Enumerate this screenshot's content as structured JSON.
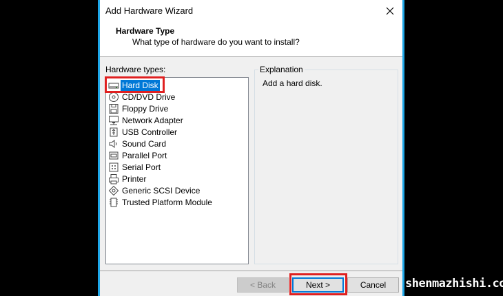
{
  "window": {
    "title": "Add Hardware Wizard"
  },
  "header": {
    "title": "Hardware Type",
    "subtitle": "What type of hardware do you want to install?"
  },
  "list": {
    "label": "Hardware types:",
    "selected_index": 0,
    "items": [
      {
        "label": "Hard Disk",
        "icon": "hard-disk-icon"
      },
      {
        "label": "CD/DVD Drive",
        "icon": "cd-dvd-drive-icon"
      },
      {
        "label": "Floppy Drive",
        "icon": "floppy-drive-icon"
      },
      {
        "label": "Network Adapter",
        "icon": "network-adapter-icon"
      },
      {
        "label": "USB Controller",
        "icon": "usb-controller-icon"
      },
      {
        "label": "Sound Card",
        "icon": "sound-card-icon"
      },
      {
        "label": "Parallel Port",
        "icon": "parallel-port-icon"
      },
      {
        "label": "Serial Port",
        "icon": "serial-port-icon"
      },
      {
        "label": "Printer",
        "icon": "printer-icon"
      },
      {
        "label": "Generic SCSI Device",
        "icon": "scsi-device-icon"
      },
      {
        "label": "Trusted Platform Module",
        "icon": "tpm-icon"
      }
    ]
  },
  "explanation": {
    "legend": "Explanation",
    "text": "Add a hard disk."
  },
  "buttons": {
    "back": "< Back",
    "next": "Next >",
    "cancel": "Cancel"
  },
  "watermark": "shenmazhishi.com",
  "colors": {
    "accent": "#0078d7",
    "highlight": "#e02020",
    "border_blue": "#1ea7e8"
  }
}
